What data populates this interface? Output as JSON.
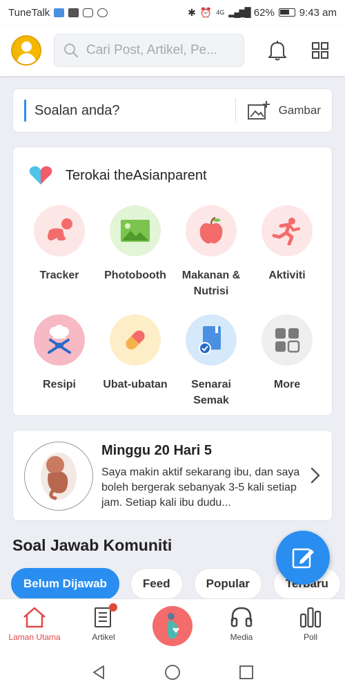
{
  "status_bar": {
    "carrier": "TuneTalk",
    "battery": "62%",
    "network": "4G",
    "time": "9:43 am"
  },
  "header": {
    "search_placeholder": "Cari Post, Artikel, Pe..."
  },
  "ask": {
    "placeholder": "Soalan anda?",
    "image_label": "Gambar"
  },
  "explore": {
    "title": "Terokai theAsianparent",
    "items": [
      {
        "label": "Tracker",
        "icon": "baby-crawl-icon",
        "bg": "#fde6e6"
      },
      {
        "label": "Photobooth",
        "icon": "photo-icon",
        "bg": "#e2f5d7"
      },
      {
        "label": "Makanan & Nutrisi",
        "icon": "apple-icon",
        "bg": "#fde6e6"
      },
      {
        "label": "Aktiviti",
        "icon": "running-icon",
        "bg": "#fde6e6"
      },
      {
        "label": "Resipi",
        "icon": "chef-icon",
        "bg": "#f7b9c4"
      },
      {
        "label": "Ubat-ubatan",
        "icon": "pill-icon",
        "bg": "#fdeec8"
      },
      {
        "label": "Senarai Semak",
        "icon": "checklist-icon",
        "bg": "#d6e9fb"
      },
      {
        "label": "More",
        "icon": "more-grid-icon",
        "bg": "#eeeeee"
      }
    ]
  },
  "pregnancy": {
    "title": "Minggu 20 Hari 5",
    "text": "Saya makin aktif sekarang ibu, dan saya boleh bergerak sebanyak 3-5 kali setiap jam. Setiap kali ibu dudu..."
  },
  "community": {
    "title": "Soal Jawab Komuniti",
    "chips": [
      "Belum Dijawab",
      "Feed",
      "Popular",
      "Terbaru"
    ]
  },
  "bottom_nav": {
    "items": [
      {
        "label": "Laman Utama",
        "icon": "home-icon",
        "active": true
      },
      {
        "label": "Artikel",
        "icon": "article-icon",
        "active": false
      },
      {
        "label": "",
        "icon": "pregnancy-icon",
        "active": false
      },
      {
        "label": "Media",
        "icon": "headphones-icon",
        "active": false
      },
      {
        "label": "Poll",
        "icon": "poll-icon",
        "active": false
      }
    ]
  },
  "colors": {
    "accent": "#2a8ef0",
    "active_nav": "#e04a4a",
    "avatar": "#f5b800"
  }
}
